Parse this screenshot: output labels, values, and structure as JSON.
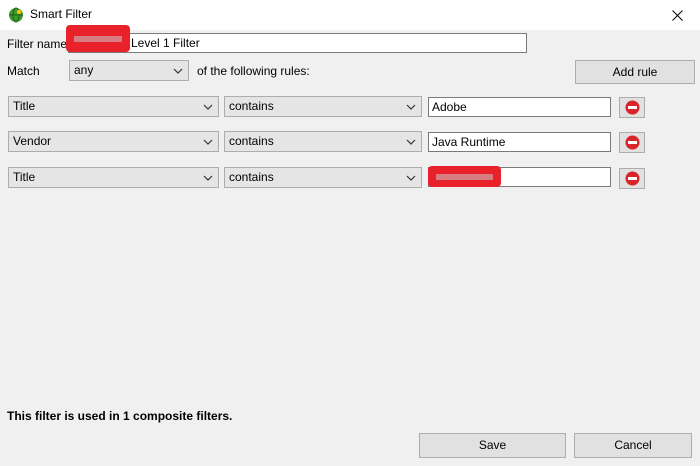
{
  "window": {
    "title": "Smart Filter",
    "close_icon": "close-icon",
    "app_icon": "bug-globe-icon"
  },
  "header": {
    "filter_name_label": "Filter name:",
    "filter_name_value": "Level 1 Filter",
    "match_label": "Match",
    "match_value": "any",
    "rules_suffix": "of the following rules:",
    "add_rule_label": "Add rule"
  },
  "rules": [
    {
      "field": "Title",
      "operator": "contains",
      "value": "Adobe"
    },
    {
      "field": "Vendor",
      "operator": "contains",
      "value": "Java Runtime"
    },
    {
      "field": "Title",
      "operator": "contains",
      "value": ""
    }
  ],
  "footer": {
    "status_text": "This filter is used in 1 composite filters.",
    "save_label": "Save",
    "cancel_label": "Cancel"
  },
  "colors": {
    "redaction": "#e8212b",
    "remove_icon": "#d9242a"
  }
}
